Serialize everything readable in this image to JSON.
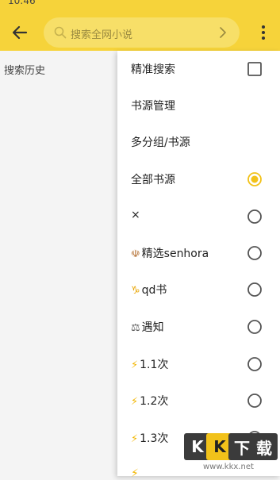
{
  "status": {
    "time": "10:46"
  },
  "appbar": {
    "back_icon": "arrow-left-icon",
    "search_placeholder": "搜索全网小说",
    "more_icon": "more-vertical-icon",
    "color": "#f6d33a"
  },
  "history": {
    "label": "搜索历史"
  },
  "menu": {
    "items": [
      {
        "label": "精准搜索",
        "control": "checkbox",
        "checked": false
      },
      {
        "label": "书源管理",
        "control": "none"
      },
      {
        "label": "多分组/书源",
        "control": "none"
      },
      {
        "label": "全部书源",
        "control": "radio",
        "checked": true
      },
      {
        "label": "×",
        "control": "radio",
        "checked": false
      },
      {
        "label": "精选senhora",
        "prefix": "☫",
        "control": "radio",
        "checked": false
      },
      {
        "label": "qd书",
        "prefix": "♑",
        "control": "radio",
        "checked": false
      },
      {
        "label": "遇知",
        "prefix": "⚖",
        "control": "radio",
        "checked": false
      },
      {
        "label": "1.1次",
        "prefix": "⚡",
        "control": "radio",
        "checked": false
      },
      {
        "label": "1.2次",
        "prefix": "⚡",
        "control": "radio",
        "checked": false
      },
      {
        "label": "1.3次",
        "prefix": "⚡",
        "control": "radio",
        "checked": false
      }
    ],
    "accent": "#f2c21a"
  },
  "watermark": {
    "letters": [
      "K",
      "K",
      "下",
      "载"
    ],
    "url": "www.kkx.net"
  }
}
